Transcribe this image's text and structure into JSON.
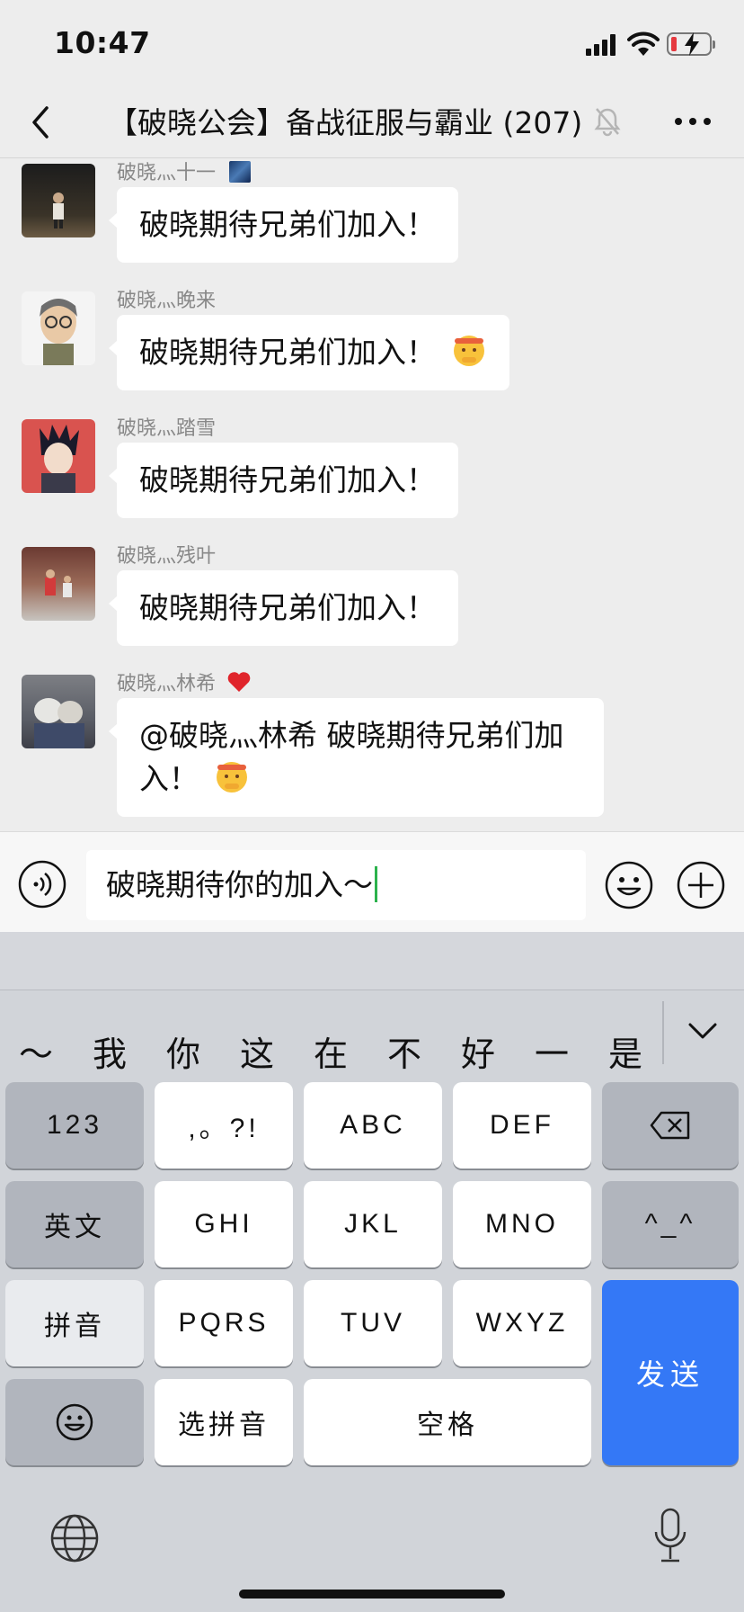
{
  "status_bar": {
    "time": "10:47"
  },
  "nav": {
    "title": "【破晓公会】备战征服与霸业 (207)"
  },
  "messages": [
    {
      "sender": "破晓灬十一",
      "text": "破晓期待兄弟们加入！"
    },
    {
      "sender": "破晓灬晚来",
      "text": "破晓期待兄弟们加入！"
    },
    {
      "sender": "破晓灬踏雪",
      "text": "破晓期待兄弟们加入！"
    },
    {
      "sender": "破晓灬残叶",
      "text": "破晓期待兄弟们加入！"
    },
    {
      "sender": "破晓灬林希",
      "text_line1": "@破晓灬林希 破晓期待兄弟们加",
      "text_line2": "入！"
    }
  ],
  "input": {
    "value": "破晓期待你的加入～"
  },
  "keyboard": {
    "candidates": [
      "～",
      "我",
      "你",
      "这",
      "在",
      "不",
      "好",
      "一",
      "是"
    ],
    "keys": {
      "num": "123",
      "punct": ",。?!",
      "abc": "ABC",
      "def": "DEF",
      "en": "英文",
      "ghi": "GHI",
      "jkl": "JKL",
      "mno": "MNO",
      "face": "^_^",
      "pinyin": "拼音",
      "pqrs": "PQRS",
      "tuv": "TUV",
      "wxyz": "WXYZ",
      "send": "发送",
      "select_pinyin": "选拼音",
      "space": "空格"
    }
  },
  "colors": {
    "background": "#ededed",
    "bubble": "#ffffff",
    "send_key": "#3478f6",
    "caret": "#2bb24c",
    "battery_low": "#e5393f"
  },
  "icons": [
    "back-icon",
    "mute-bell-icon",
    "more-icon",
    "voice-icon",
    "emoji-icon",
    "plus-icon",
    "backspace-icon",
    "emoji-key-icon",
    "globe-icon",
    "mic-icon",
    "chevron-down-icon"
  ]
}
